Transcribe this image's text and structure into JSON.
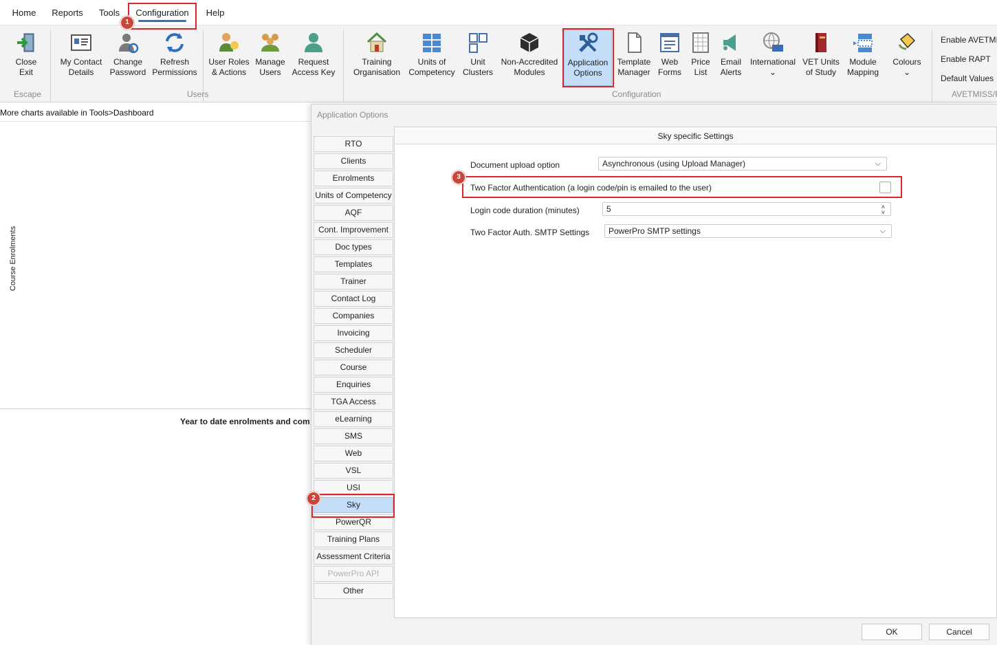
{
  "menu": {
    "tabs": [
      "Home",
      "Reports",
      "Tools",
      "Configuration",
      "Help"
    ]
  },
  "ribbon": {
    "escape_group": {
      "label": "Escape",
      "close_exit": "Close\nExit"
    },
    "users_group": {
      "label": "Users",
      "my_contact": "My Contact\nDetails",
      "change_password": "Change\nPassword",
      "refresh_permissions": "Refresh\nPermissions",
      "user_roles": "User Roles\n& Actions",
      "manage_users": "Manage\nUsers",
      "request_key": "Request\nAccess Key"
    },
    "config_group": {
      "label": "Configuration",
      "training_org": "Training\nOrganisation",
      "units": "Units of\nCompetency",
      "unit_clusters": "Unit\nClusters",
      "non_accredited": "Non-Accredited\nModules",
      "app_options": "Application\nOptions",
      "template_manager": "Template\nManager",
      "web_forms": "Web\nForms",
      "price_list": "Price\nList",
      "email_alerts": "Email\nAlerts",
      "international": "International",
      "vet_units": "VET Units\nof Study",
      "module_mapping": "Module\nMapping",
      "colours": "Colours",
      "chevron": "⌄"
    },
    "avetmiss_group": {
      "label": "AVETMISS/R",
      "enable_avetmiss": "Enable AVETMIS",
      "enable_rapt": "Enable RAPT",
      "default_values": "Default Values"
    }
  },
  "dashboard": {
    "info": "More charts available in Tools>Dashboard",
    "y_label": "Course Enrolments",
    "chart2_title": "Year to date enrolments and com"
  },
  "dialog": {
    "title": "Application Options",
    "tabs": [
      "RTO",
      "Clients",
      "Enrolments",
      "Units of Competency",
      "AQF",
      "Cont. Improvement",
      "Doc types",
      "Templates",
      "Trainer",
      "Contact Log",
      "Companies",
      "Invoicing",
      "Scheduler",
      "Course",
      "Enquiries",
      "TGA Access",
      "eLearning",
      "SMS",
      "Web",
      "VSL",
      "USI",
      "Sky",
      "PowerQR",
      "Training Plans",
      "Assessment Criteria",
      "PowerPro API",
      "Other"
    ],
    "selected_tab": "Sky",
    "disabled_tab": "PowerPro API",
    "panel": {
      "title": "Sky specific Settings",
      "upload_label": "Document upload option",
      "upload_value": "Asynchronous (using Upload Manager)",
      "tfa_label": "Two Factor Authentication (a login code/pin is emailed to the user)",
      "tfa_checked": false,
      "duration_label": "Login code duration (minutes)",
      "duration_value": "5",
      "smtp_label": "Two Factor Auth. SMTP Settings",
      "smtp_value": "PowerPro SMTP settings"
    },
    "ok": "OK",
    "cancel": "Cancel"
  },
  "annotations": [
    "1",
    "2",
    "3"
  ],
  "colors": {
    "highlight": "#d9262b",
    "selection": "#c4defa",
    "accent": "#3a6db5"
  }
}
